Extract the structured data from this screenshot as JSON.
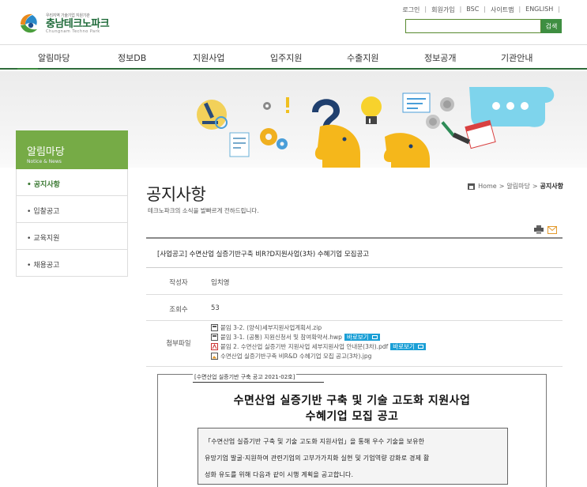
{
  "header": {
    "logo_small": "우리지역 기술기업 지원기관",
    "logo_main": "충남테크노파크",
    "logo_eng": "Chungnam Techno Park",
    "util_links": [
      "로그인",
      "회원가입",
      "BSC",
      "사이트맵",
      "ENGLISH"
    ],
    "search": {
      "placeholder": "",
      "button_label": "검색"
    }
  },
  "nav": {
    "items": [
      "알림마당",
      "정보DB",
      "지원사업",
      "입주지원",
      "수출지원",
      "정보공개",
      "기관안내"
    ],
    "accent_color": "#2f6b3a"
  },
  "sidebar": {
    "title": "알림마당",
    "subtitle": "Notice & News",
    "items": [
      {
        "label": "공지사항",
        "active": true
      },
      {
        "label": "입찰공고",
        "active": false
      },
      {
        "label": "교육지원",
        "active": false
      },
      {
        "label": "채용공고",
        "active": false
      }
    ],
    "accent_color": "#76ab46"
  },
  "page": {
    "title": "공지사항",
    "description": "테크노파크의 소식을 발빠르게 전하드립니다.",
    "breadcrumb": [
      "Home",
      "알림마당",
      "공지사항"
    ],
    "tools": [
      "print-icon",
      "email-icon"
    ]
  },
  "post": {
    "title": "[사업공고] 수면산업 실증기반구축 비R?D지원사업(3차) 수혜기업 모집공고",
    "author_label": "작성자",
    "author": "임치영",
    "views_label": "조회수",
    "views": "53",
    "files_label": "첨부파일",
    "files": [
      {
        "icon": "archive-file-icon",
        "name": "붙임 3-2. (양식)세부지원사업계획서.zip",
        "viewer": ""
      },
      {
        "icon": "hwp-file-icon",
        "name": "붙임 3-1. (공통) 지원신청서 및 참여확약서.hwp",
        "viewer": "바로보기"
      },
      {
        "icon": "pdf-file-icon",
        "name": "붙임 2. 수면산업 실증기반 지원사업 세부지원사업 안내문(3차).pdf",
        "viewer": "바로보기"
      },
      {
        "icon": "image-file-icon",
        "name": "수면산업 실증기반구축 비R&D 수혜기업 모집 공고(3차).jpg",
        "viewer": ""
      }
    ]
  },
  "document_image": {
    "ref": "[수면산업 실증기반 구축 공고 2021-02호]",
    "title_line1": "수면산업 실증기반 구축 및 기술 고도화 지원사업",
    "title_line2": "수혜기업 모집 공고",
    "body_lines": [
      "「수면산업 실증기반 구축 및 기술 고도화 지원사업」을 통해 우수 기술을 보유한",
      "유망기업 발굴·지원하여 관련기업의 고부가가치화 실현 및 기업역량 강화로 경제 활",
      "성화 유도를 위해 다음과 같이 시행 계획을 공고합니다."
    ]
  }
}
